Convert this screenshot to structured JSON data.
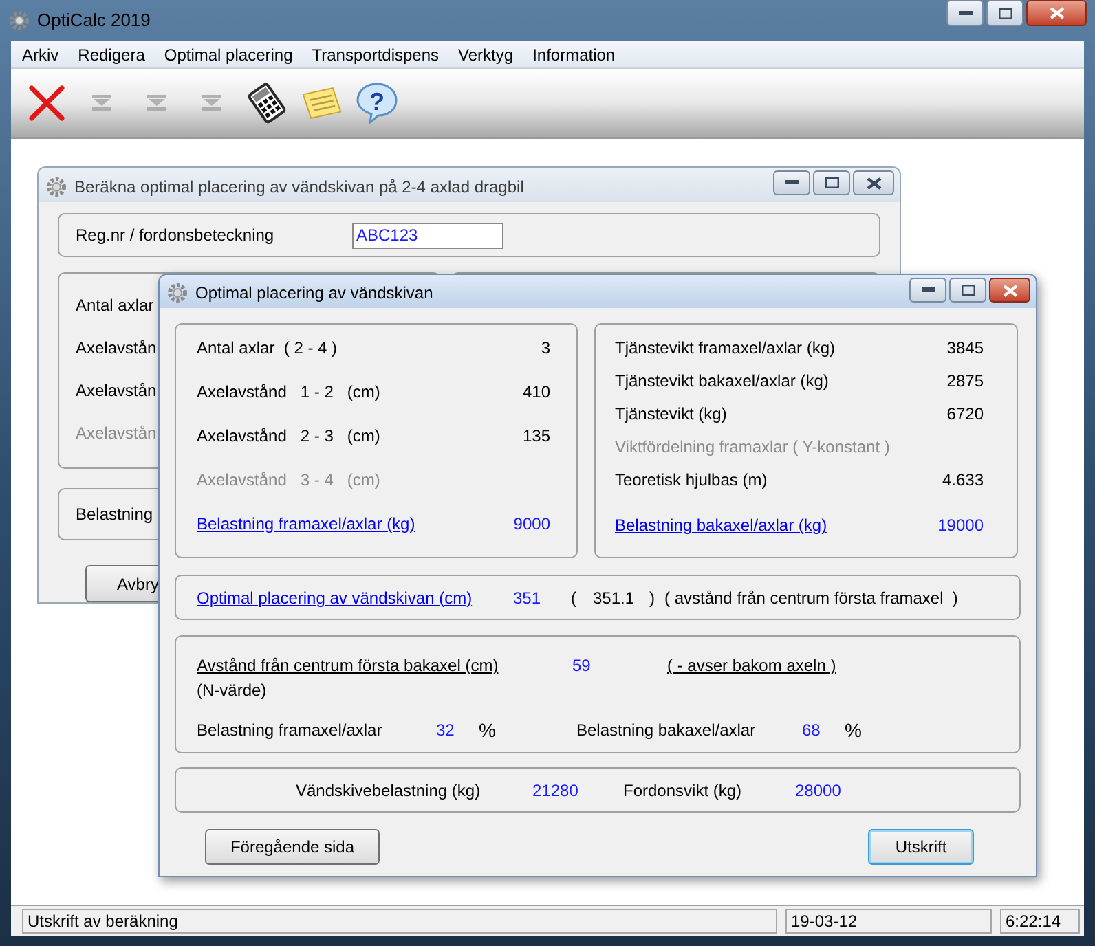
{
  "window": {
    "title": "OptiCalc 2019",
    "active": true
  },
  "menu": [
    "Arkiv",
    "Redigera",
    "Optimal placering",
    "Transportdispens",
    "Verktyg",
    "Information"
  ],
  "toolbar": [
    {
      "kind": "delete",
      "disabled": false
    },
    {
      "kind": "arrow",
      "disabled": true
    },
    {
      "kind": "arrow",
      "disabled": true
    },
    {
      "kind": "arrow",
      "disabled": true
    },
    {
      "kind": "calculator",
      "disabled": false
    },
    {
      "kind": "note",
      "disabled": false
    },
    {
      "kind": "help",
      "disabled": false,
      "symbol": "?"
    }
  ],
  "back_dialog": {
    "title": "Beräkna optimal placering av vändskivan på 2-4 axlad dragbil",
    "active": false,
    "reg_label": "Reg.nr / fordonsbeteckning",
    "reg_value": "ABC123",
    "rows": [
      {
        "label": "Antal axlar",
        "dimmed": false
      },
      {
        "label": "Axelavstån",
        "dimmed": false
      },
      {
        "label": "Axelavstån",
        "dimmed": false
      },
      {
        "label": "Axelavstån",
        "dimmed": true
      }
    ],
    "load_label": "Belastning",
    "cancel_button": "Avbry"
  },
  "front_dialog": {
    "title": "Optimal placering av vändskivan",
    "active": true,
    "axle_panel": [
      {
        "kind": "plain",
        "label": "Antal axlar  ( 2 - 4 )",
        "value": "3"
      },
      {
        "kind": "plain",
        "label": "Axelavstånd   1 - 2   (cm)",
        "value": "410"
      },
      {
        "kind": "plain",
        "label": "Axelavstånd   2 - 3   (cm)",
        "value": "135"
      },
      {
        "kind": "dimmed",
        "label": "Axelavstånd   3 - 4   (cm)"
      },
      {
        "kind": "link",
        "label": "Belastning framaxel/axlar (kg)",
        "value": "9000"
      }
    ],
    "weight_panel": [
      {
        "kind": "plain",
        "label": "Tjänstevikt framaxel/axlar (kg)",
        "value": "3845"
      },
      {
        "kind": "plain",
        "label": "Tjänstevikt bakaxel/axlar (kg)",
        "value": "2875"
      },
      {
        "kind": "plain",
        "label": "Tjänstevikt (kg)",
        "value": "6720"
      },
      {
        "kind": "dimmed",
        "label": "Viktfördelning framaxlar ( Y-konstant )"
      },
      {
        "kind": "plain",
        "label": "Teoretisk hjulbas (m)",
        "value": "4.633"
      },
      {
        "kind": "link",
        "label": "Belastning bakaxel/axlar (kg)",
        "value": "19000"
      }
    ],
    "placement": {
      "label": "Optimal placering av vändskivan (cm)",
      "value": "351",
      "open_paren": "(",
      "exact_value": "351.1",
      "close_paren": ")",
      "note": "( avstånd från centrum första framaxel  )"
    },
    "rear": {
      "label": "Avstånd från centrum första bakaxel (cm)",
      "value": "59",
      "note": "( - avser bakom axeln )",
      "sublabel": "(N-värde)",
      "front_share_label": "Belastning framaxel/axlar",
      "front_share": "32",
      "front_unit": "%",
      "rear_share_label": "Belastning bakaxel/axlar",
      "rear_share": "68",
      "rear_unit": "%"
    },
    "totals": {
      "plate_label": "Vändskivebelastning (kg)",
      "plate_value": "21280",
      "vehicle_label": "Fordonsvikt (kg)",
      "vehicle_value": "28000"
    },
    "buttons": [
      {
        "label": "Föregående sida",
        "default": false
      },
      {
        "label": "Utskrift",
        "default": true
      }
    ]
  },
  "status_bar": [
    "Utskrift av beräkning",
    "19-03-12",
    "6:22:14"
  ]
}
